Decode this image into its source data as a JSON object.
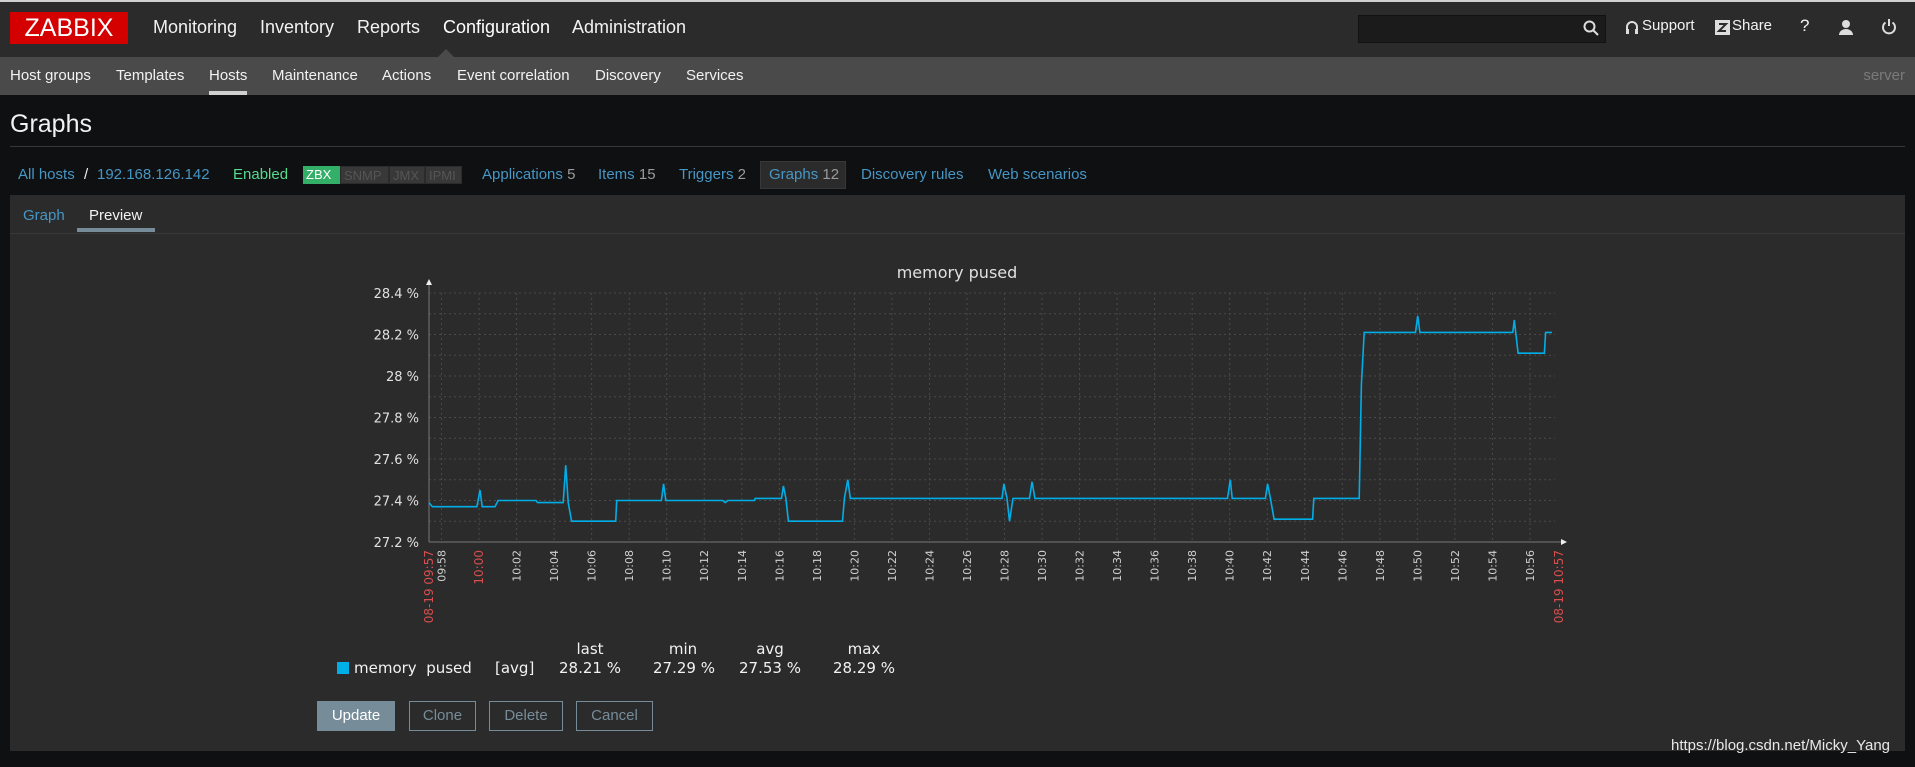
{
  "header": {
    "logo": "ZABBIX",
    "menu": [
      "Monitoring",
      "Inventory",
      "Reports",
      "Configuration",
      "Administration"
    ],
    "active_menu": "Configuration",
    "search": {
      "value": "",
      "placeholder": ""
    },
    "support_label": "Support",
    "share_label": "Share",
    "help_label": "?"
  },
  "subnav": {
    "items": [
      "Host groups",
      "Templates",
      "Hosts",
      "Maintenance",
      "Actions",
      "Event correlation",
      "Discovery",
      "Services"
    ],
    "active": "Hosts",
    "server_label": "server"
  },
  "page_title": "Graphs",
  "host_nav": {
    "all_hosts": "All hosts",
    "separator": "/",
    "host": "192.168.126.142",
    "status": "Enabled",
    "badges": [
      "ZBX",
      "SNMP",
      "JMX",
      "IPMI"
    ],
    "links": [
      {
        "label": "Applications",
        "count": "5"
      },
      {
        "label": "Items",
        "count": "15"
      },
      {
        "label": "Triggers",
        "count": "2"
      },
      {
        "label": "Graphs",
        "count": "12"
      },
      {
        "label": "Discovery rules",
        "count": ""
      },
      {
        "label": "Web scenarios",
        "count": ""
      }
    ]
  },
  "tabs": [
    "Graph",
    "Preview"
  ],
  "active_tab": "Preview",
  "chart_data": {
    "type": "line",
    "title": "memory pused",
    "xlim": [
      "09:57:20",
      "10:57:20"
    ],
    "ylim": [
      27.2,
      28.4
    ],
    "y_ticks": [
      "27.2 %",
      "27.4 %",
      "27.6 %",
      "27.8 %",
      "28 %",
      "28.2 %",
      "28.4 %"
    ],
    "y_tick_values": [
      27.2,
      27.4,
      27.6,
      27.8,
      28.0,
      28.2,
      28.4
    ],
    "x_ticks": [
      "09:58",
      "10:00",
      "10:02",
      "10:04",
      "10:06",
      "10:08",
      "10:10",
      "10:12",
      "10:14",
      "10:16",
      "10:18",
      "10:20",
      "10:22",
      "10:24",
      "10:26",
      "10:28",
      "10:30",
      "10:32",
      "10:34",
      "10:36",
      "10:38",
      "10:40",
      "10:42",
      "10:44",
      "10:46",
      "10:48",
      "10:50",
      "10:52",
      "10:54",
      "10:56"
    ],
    "x_start_label": "08-19 09:57",
    "x_end_label": "08-19 10:57",
    "highlight_tick": "10:00",
    "grid": true,
    "series": [
      {
        "name": "memory  pused",
        "color": "#00aee8",
        "points": [
          [
            "09:57:20",
            27.39
          ],
          [
            "09:57:31",
            27.37
          ],
          [
            "09:59:53",
            27.37
          ],
          [
            "10:00:03",
            27.45
          ],
          [
            "10:00:10",
            27.37
          ],
          [
            "10:00:51",
            27.37
          ],
          [
            "10:01:01",
            27.4
          ],
          [
            "10:03:02",
            27.4
          ],
          [
            "10:03:07",
            27.39
          ],
          [
            "10:04:29",
            27.39
          ],
          [
            "10:04:37",
            27.57
          ],
          [
            "10:04:45",
            27.39
          ],
          [
            "10:04:56",
            27.3
          ],
          [
            "10:07:17",
            27.3
          ],
          [
            "10:07:20",
            27.4
          ],
          [
            "10:09:43",
            27.4
          ],
          [
            "10:09:50",
            27.48
          ],
          [
            "10:09:57",
            27.4
          ],
          [
            "10:12:59",
            27.4
          ],
          [
            "10:13:07",
            27.39
          ],
          [
            "10:13:15",
            27.4
          ],
          [
            "10:14:40",
            27.4
          ],
          [
            "10:14:43",
            27.41
          ],
          [
            "10:16:07",
            27.41
          ],
          [
            "10:16:13",
            27.47
          ],
          [
            "10:16:21",
            27.41
          ],
          [
            "10:16:29",
            27.3
          ],
          [
            "10:19:22",
            27.3
          ],
          [
            "10:19:28",
            27.41
          ],
          [
            "10:19:39",
            27.5
          ],
          [
            "10:19:47",
            27.41
          ],
          [
            "10:27:52",
            27.41
          ],
          [
            "10:27:58",
            27.48
          ],
          [
            "10:28:08",
            27.41
          ],
          [
            "10:28:16",
            27.3
          ],
          [
            "10:28:27",
            27.41
          ],
          [
            "10:29:20",
            27.41
          ],
          [
            "10:29:28",
            27.49
          ],
          [
            "10:29:37",
            27.41
          ],
          [
            "10:39:53",
            27.41
          ],
          [
            "10:40:02",
            27.5
          ],
          [
            "10:40:08",
            27.41
          ],
          [
            "10:41:54",
            27.41
          ],
          [
            "10:42:01",
            27.48
          ],
          [
            "10:42:10",
            27.41
          ],
          [
            "10:42:22",
            27.31
          ],
          [
            "10:44:25",
            27.31
          ],
          [
            "10:44:29",
            27.41
          ],
          [
            "10:46:54",
            27.41
          ],
          [
            "10:47:01",
            27.96
          ],
          [
            "10:47:10",
            28.21
          ],
          [
            "10:49:54",
            28.21
          ],
          [
            "10:50:01",
            28.29
          ],
          [
            "10:50:08",
            28.21
          ],
          [
            "10:55:05",
            28.21
          ],
          [
            "10:55:10",
            28.27
          ],
          [
            "10:55:22",
            28.11
          ],
          [
            "10:56:46",
            28.11
          ],
          [
            "10:56:50",
            28.21
          ],
          [
            "10:57:10",
            28.21
          ]
        ]
      }
    ],
    "legend": {
      "headers": [
        "last",
        "min",
        "avg",
        "max"
      ],
      "name": "memory  pused",
      "func": "[avg]",
      "values": [
        "28.21 %",
        "27.29 %",
        "27.53 %",
        "28.29 %"
      ]
    }
  },
  "buttons": {
    "update": "Update",
    "clone": "Clone",
    "delete": "Delete",
    "cancel": "Cancel"
  },
  "watermark": "https://blog.csdn.net/Micky_Yang"
}
